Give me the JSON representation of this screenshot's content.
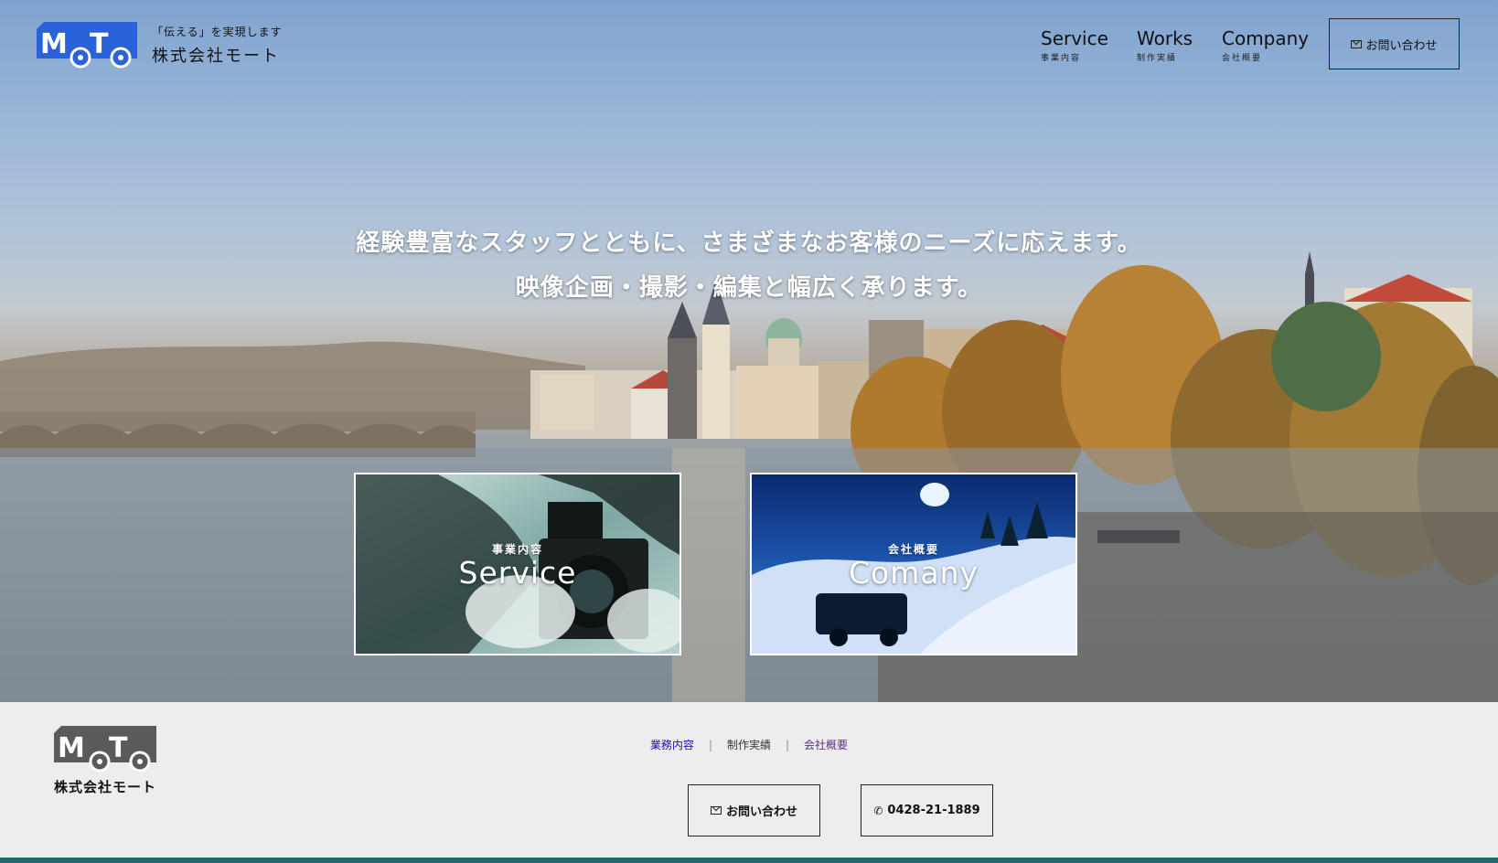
{
  "header": {
    "logo_text": "MoTo",
    "tagline": "「伝える」を実現します",
    "company_name": "株式会社モート",
    "nav": [
      {
        "en": "Service",
        "ja": "事業内容"
      },
      {
        "en": "Works",
        "ja": "制作実績"
      },
      {
        "en": "Company",
        "ja": "会社概要"
      }
    ],
    "contact_label": "お問い合わせ"
  },
  "hero": {
    "headline_line1": "経験豊富なスタッフとともに、さまざまなお客様のニーズに応えます。",
    "headline_line2": "映像企画・撮影・編集と幅広く承ります。"
  },
  "cards": [
    {
      "sub": "事業内容",
      "title": "Service"
    },
    {
      "sub": "会社概要",
      "title": "Comany"
    }
  ],
  "footer": {
    "logo_text": "MoTo",
    "company_name": "株式会社モート",
    "links": [
      {
        "label": "業務内容",
        "color": "#1a0dab"
      },
      {
        "label": "制作実績",
        "color": "#333333"
      },
      {
        "label": "会社概要",
        "color": "#5b2a9a"
      }
    ],
    "contact_label": "お問い合わせ",
    "phone": "0428-21-1889"
  },
  "colors": {
    "logo_blue": "#2a63d9",
    "footer_logo_gray": "#5a5a5a",
    "bottom_bar": "#1f6f6e"
  }
}
